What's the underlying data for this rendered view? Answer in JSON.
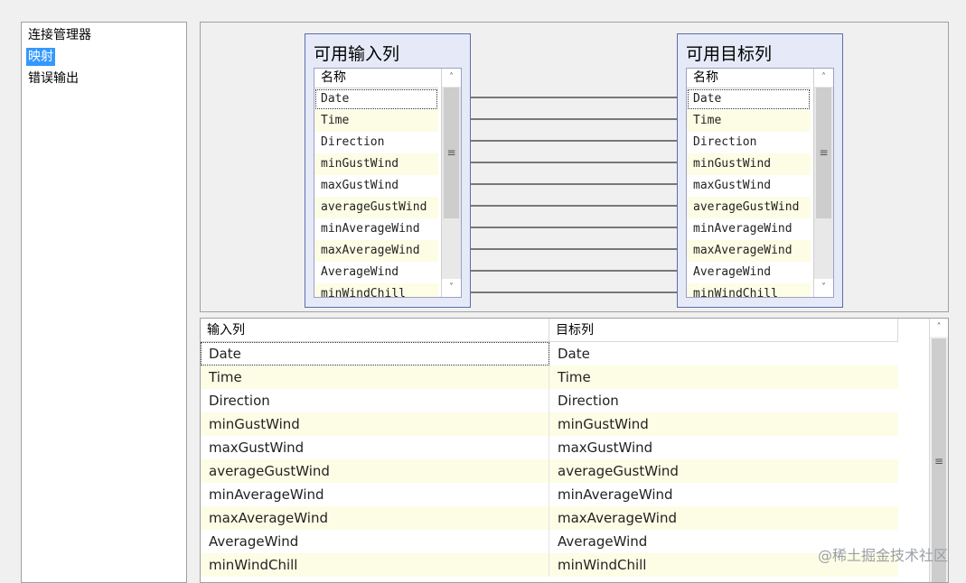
{
  "nav": {
    "items": [
      {
        "label": "连接管理器",
        "selected": false
      },
      {
        "label": "映射",
        "selected": true
      },
      {
        "label": "错误输出",
        "selected": false
      }
    ]
  },
  "input_table": {
    "title": "可用输入列",
    "header": "名称",
    "columns": [
      "Date",
      "Time",
      "Direction",
      "minGustWind",
      "maxGustWind",
      "averageGustWind",
      "minAverageWind",
      "maxAverageWind",
      "AverageWind",
      "minWindChill"
    ]
  },
  "dest_table": {
    "title": "可用目标列",
    "header": "名称",
    "columns": [
      "Date",
      "Time",
      "Direction",
      "minGustWind",
      "maxGustWind",
      "averageGustWind",
      "minAverageWind",
      "maxAverageWind",
      "AverageWind",
      "minWindChill"
    ]
  },
  "mapping_grid": {
    "headers": {
      "input": "输入列",
      "dest": "目标列"
    },
    "rows": [
      {
        "input": "Date",
        "dest": "Date"
      },
      {
        "input": "Time",
        "dest": "Time"
      },
      {
        "input": "Direction",
        "dest": "Direction"
      },
      {
        "input": "minGustWind",
        "dest": "minGustWind"
      },
      {
        "input": "maxGustWind",
        "dest": "maxGustWind"
      },
      {
        "input": "averageGustWind",
        "dest": "averageGustWind"
      },
      {
        "input": "minAverageWind",
        "dest": "minAverageWind"
      },
      {
        "input": "maxAverageWind",
        "dest": "maxAverageWind"
      },
      {
        "input": "AverageWind",
        "dest": "AverageWind"
      },
      {
        "input": "minWindChill",
        "dest": "minWindChill"
      }
    ]
  },
  "icons": {
    "scroll_up": "chevron-up-icon",
    "scroll_down": "chevron-down-icon",
    "scroll_grip": "grip-icon"
  },
  "colors": {
    "selection": "#3399ff",
    "alt_row": "#fdfde6",
    "table_box": "#e6eaf8"
  },
  "watermark": "@稀土掘金技术社区"
}
